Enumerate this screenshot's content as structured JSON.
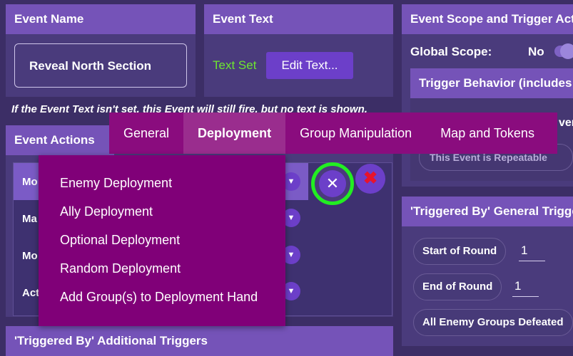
{
  "event_name": {
    "header": "Event Name",
    "value": "Reveal North Section"
  },
  "event_text": {
    "header": "Event Text",
    "status": "Text Set",
    "status_color": "#6ee630",
    "edit_button": "Edit Text..."
  },
  "info_note": "If the Event Text isn't set, this Event will still fire, but no text is shown.",
  "scope": {
    "header": "Event Scope and Trigger Activ",
    "global_scope_label": "Global Scope:",
    "global_scope_value": "No",
    "trigger_behavior_header": "Trigger Behavior (includes 'A",
    "trigger_behavior_partial": "ver",
    "repeatable_button": "This Event is Repeatable"
  },
  "event_actions": {
    "header": "Event Actions",
    "rows": [
      {
        "label": "Mo"
      },
      {
        "label": "Ma"
      },
      {
        "label": "Mo"
      },
      {
        "label": "Act"
      }
    ]
  },
  "triggered_general": {
    "header": "'Triggered By' General Trigger",
    "items": [
      {
        "label": "Start of Round",
        "value": "1"
      },
      {
        "label": "End of Round",
        "value": "1"
      },
      {
        "label": "All Enemy Groups Defeated"
      }
    ]
  },
  "triggered_additional": {
    "header": "'Triggered By' Additional Triggers"
  },
  "tabs": [
    {
      "label": "General",
      "active": false
    },
    {
      "label": "Deployment",
      "active": true
    },
    {
      "label": "Group Manipulation",
      "active": false
    },
    {
      "label": "Map and Tokens",
      "active": false
    }
  ],
  "deployment_menu": [
    "Enemy Deployment",
    "Ally Deployment",
    "Optional Deployment",
    "Random Deployment",
    "Add Group(s) to Deployment Hand"
  ],
  "controls": {
    "close_icon": "x-icon",
    "remove_icon": "red-x-icon",
    "highlight_color": "#22ee22",
    "remove_color": "#e8132c"
  }
}
